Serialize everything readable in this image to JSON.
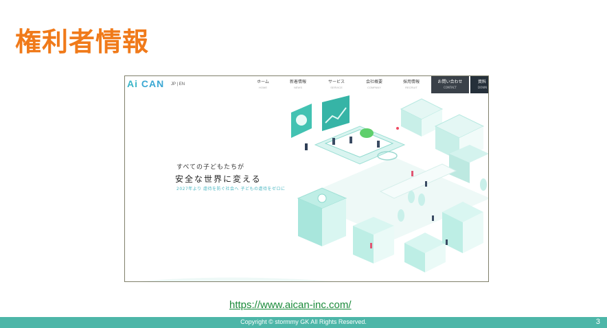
{
  "slide": {
    "title": "権利者情報",
    "url": "https://www.aican-inc.com/",
    "copyright": "Copyright © stormmy GK All Rights Reserved.",
    "page_number": "3"
  },
  "site": {
    "logo": {
      "part1": "Ai",
      "part2": " CAN"
    },
    "lang": "JP | EN",
    "nav": [
      {
        "label": "ホーム",
        "sub": "HOME"
      },
      {
        "label": "新着情報",
        "sub": "NEWS"
      },
      {
        "label": "サービス",
        "sub": "SERVICE"
      },
      {
        "label": "会社概要",
        "sub": "COMPANY"
      },
      {
        "label": "採用情報",
        "sub": "RECRUIT"
      }
    ],
    "contact": {
      "label": "お問い合わせ",
      "sub": "CONTACT"
    },
    "document": {
      "label": "資料",
      "sub": "DOWN"
    },
    "hero": {
      "line1": "すべての子どもたちが",
      "line2": "安全な世界に変える",
      "line3": "2027年より 虐待を防ぐ社会へ 子どもの虐待をゼロに"
    }
  },
  "colors": {
    "title": "#f07a1a",
    "footer": "#4db6a8",
    "link": "#1a8a3a",
    "accent": "#5fd2c4"
  }
}
